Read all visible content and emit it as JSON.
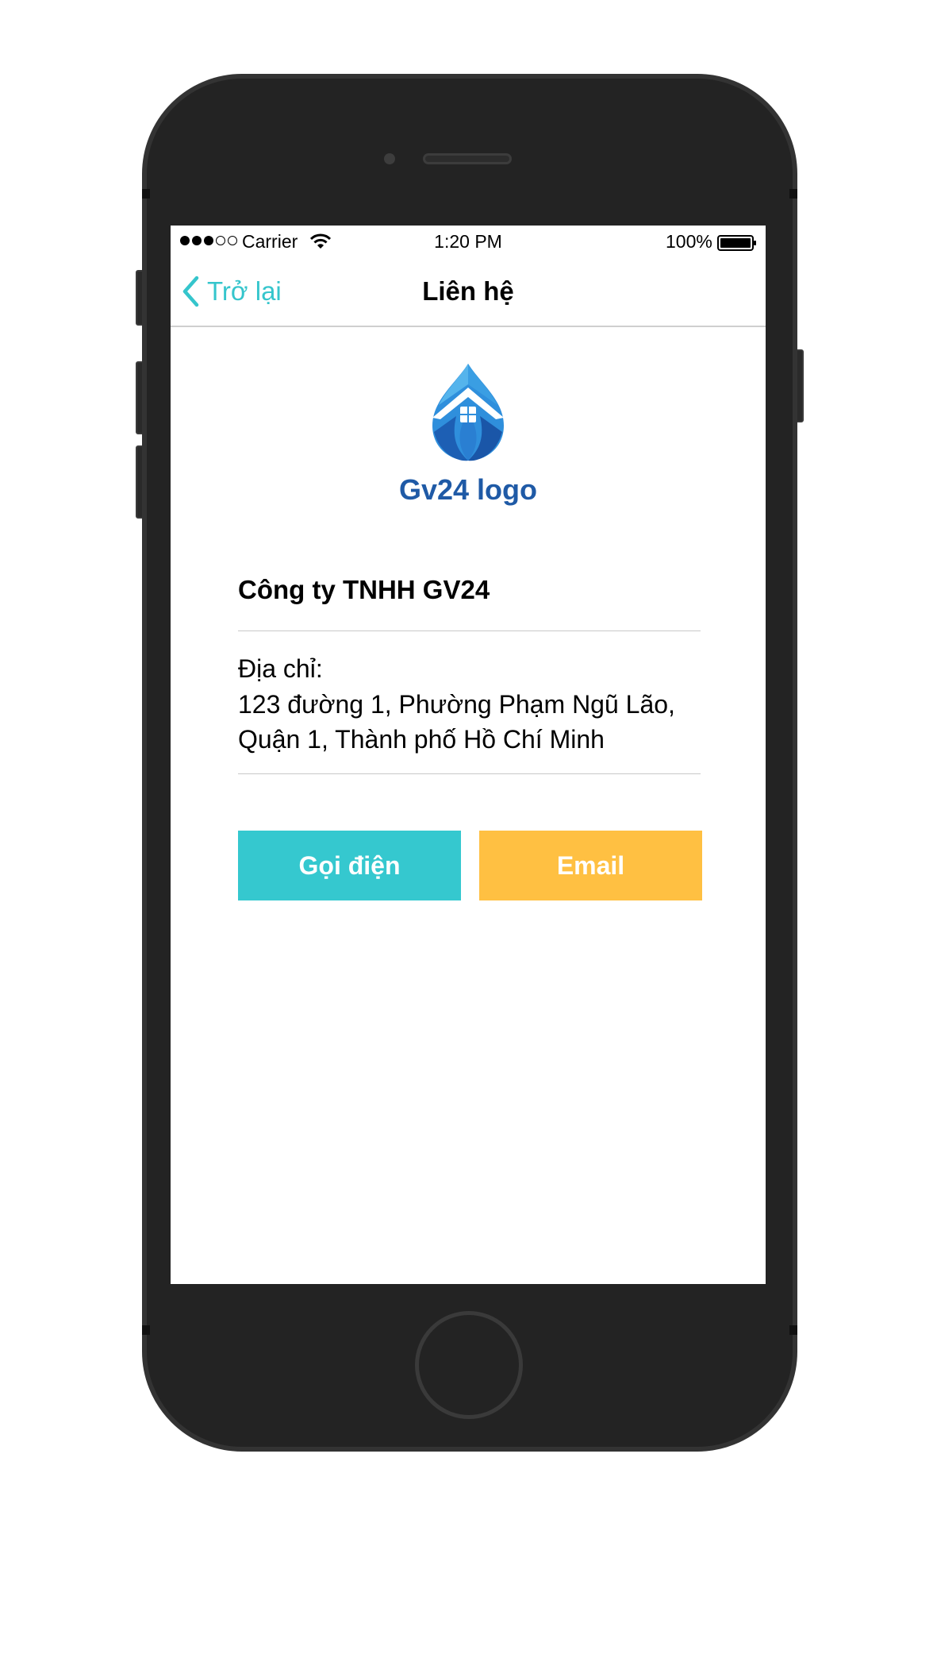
{
  "status_bar": {
    "carrier": "Carrier",
    "time": "1:20 PM",
    "battery": "100%",
    "signal_bars_full": 3,
    "signal_bars_total": 5
  },
  "nav": {
    "back_label": "Trở lại",
    "title": "Liên hệ"
  },
  "logo": {
    "text": "Gv24 logo"
  },
  "company": {
    "name": "Công ty TNHH GV24"
  },
  "address": {
    "label": "Địa chỉ:",
    "line1": "123 đường 1, Phường Phạm Ngũ Lão,",
    "line2": "Quận 1, Thành phố Hồ Chí Minh"
  },
  "actions": {
    "call_label": "Gọi điện",
    "email_label": "Email"
  },
  "colors": {
    "accent": "#35c8cf",
    "email_button": "#ffc042",
    "logo_text": "#1f5aa6"
  }
}
